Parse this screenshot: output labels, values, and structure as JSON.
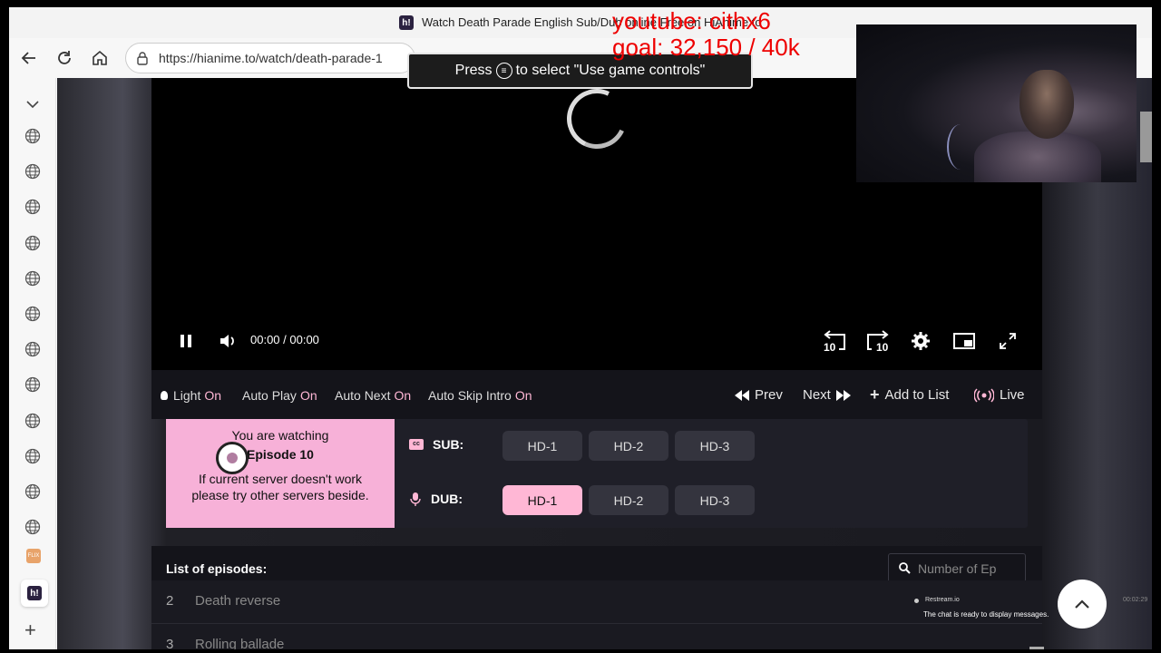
{
  "browser": {
    "tab_title": "Watch Death Parade English Sub/Dub online Free on HiAnime.to",
    "tab_favicon": "h!",
    "url": "https://hianime.to/watch/death-parade-1",
    "nav": {
      "back": "back-icon",
      "reload": "reload-icon",
      "home": "home-icon",
      "lock": "lock-icon"
    }
  },
  "sidebar": {
    "tabs_count_icons": "globe-icon",
    "active_favicon": "h!",
    "netflix_label": "FLIX",
    "add_symbol": "+"
  },
  "overlay": {
    "line1": "youtube: cithx6",
    "line2": "goal: 32,150  / 40k"
  },
  "toast": {
    "prefix": "Press",
    "icon": "menu-button-icon",
    "suffix": "to select \"Use game controls\""
  },
  "player": {
    "time": "00:00  /  00:00",
    "rewind_label": "10",
    "forward_label": "10"
  },
  "options": {
    "light_label": "Light",
    "light_value": "On",
    "autoplay_label": "Auto Play",
    "autoplay_value": "On",
    "autonext_label": "Auto Next",
    "autonext_value": "On",
    "autoskip_label": "Auto Skip Intro",
    "autoskip_value": "On",
    "prev_label": "Prev",
    "next_label": "Next",
    "add_label": "Add to List",
    "live_label": "Live"
  },
  "notice": {
    "line1": "You are watching",
    "line2": "Episode 10",
    "line3": "If current server doesn't work please try other servers beside."
  },
  "servers": {
    "sub_label": "SUB:",
    "dub_label": "DUB:",
    "sub": [
      "HD-1",
      "HD-2",
      "HD-3"
    ],
    "dub": [
      "HD-1",
      "HD-2",
      "HD-3"
    ],
    "active_dub": "HD-1"
  },
  "episodes": {
    "title": "List of episodes:",
    "search_placeholder": "Number of Ep",
    "rows": [
      {
        "num": "2",
        "name": "Death reverse"
      },
      {
        "num": "3",
        "name": "Rolling ballade"
      }
    ]
  },
  "chat": {
    "source": "Restream.io",
    "message": "The chat is ready to display messages.",
    "time": "00:02:29"
  },
  "colors": {
    "accent": "#ffb7d5",
    "overlay_text": "#ee0000"
  }
}
